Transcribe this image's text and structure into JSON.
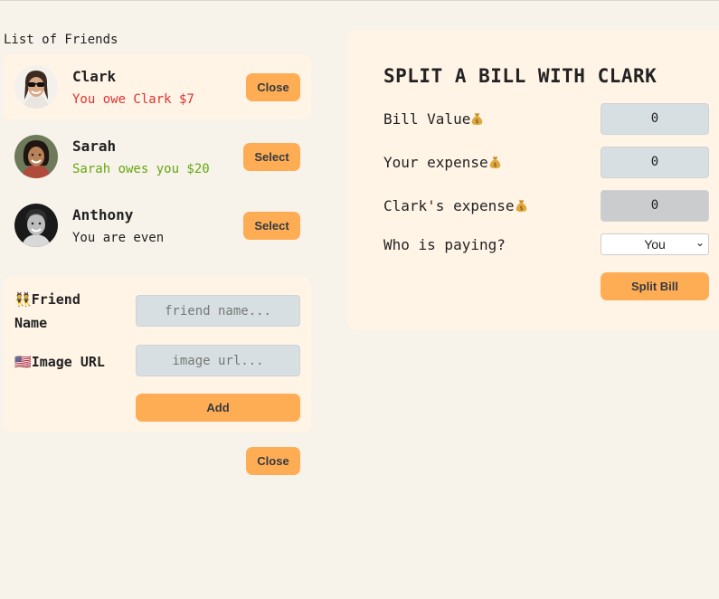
{
  "sidebar": {
    "heading": "List of Friends",
    "friends": [
      {
        "name": "Clark",
        "status": "You owe Clark $7",
        "button": "Close"
      },
      {
        "name": "Sarah",
        "status": "Sarah owes you $20",
        "button": "Select"
      },
      {
        "name": "Anthony",
        "status": "You are even",
        "button": "Select"
      }
    ]
  },
  "add_form": {
    "friend_name_label": "Friend Name",
    "friend_name_emoji": "👯",
    "friend_name_placeholder": "friend name...",
    "image_url_label": "Image URL",
    "image_url_emoji": "🇺🇸",
    "image_url_placeholder": "image url...",
    "add_button": "Add"
  },
  "close_form_button": "Close",
  "split": {
    "title": "SPLIT A BILL WITH CLARK",
    "bill_value_label": "Bill Value",
    "bill_value": "0",
    "your_expense_label": "Your expense",
    "your_expense": "0",
    "friend_expense_label": "Clark's expense",
    "friend_expense": "0",
    "who_paying_label": "Who is paying?",
    "who_paying_value": "You",
    "submit_button": "Split Bill"
  },
  "colors": {
    "accent": "#ffad55",
    "panel": "#fff4e6",
    "background": "#f7f2ea",
    "owe_red": "#e03131",
    "owed_green": "#66a80f"
  }
}
